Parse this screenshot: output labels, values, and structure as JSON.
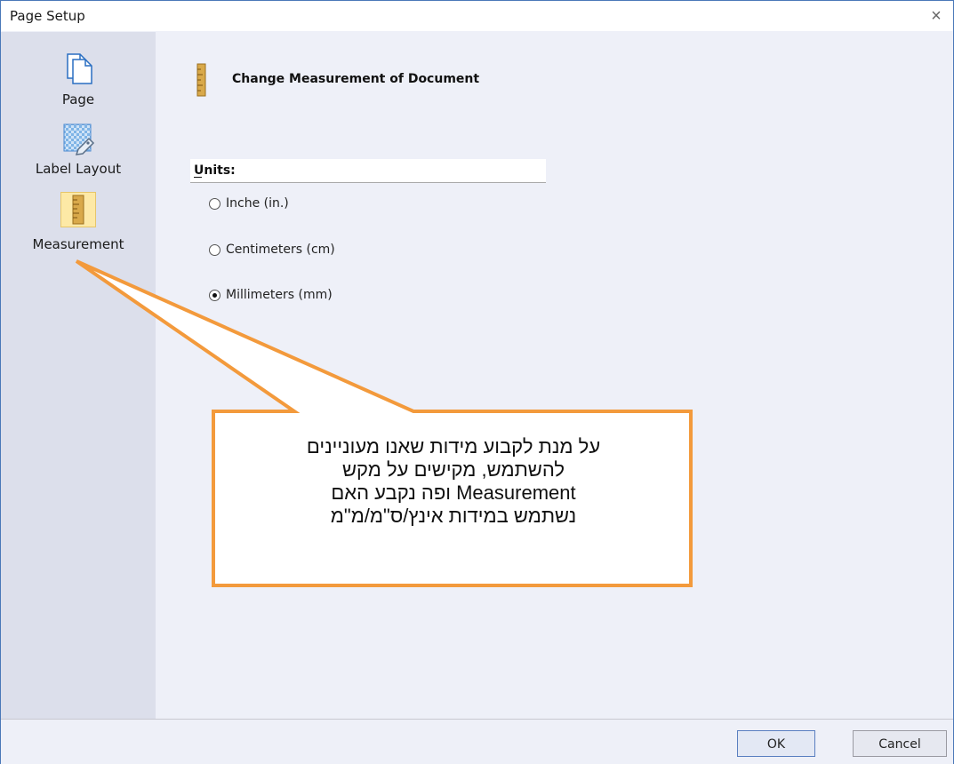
{
  "window": {
    "title": "Page Setup",
    "close_glyph": "×"
  },
  "nav": {
    "items": [
      {
        "label": "Page",
        "icon": "page-icon"
      },
      {
        "label": "Label Layout",
        "icon": "label-layout-icon"
      },
      {
        "label": "Measurement",
        "icon": "ruler-icon",
        "selected": true
      }
    ]
  },
  "content": {
    "heading": "Change Measurement of Document",
    "units_label": "Units:",
    "options": [
      {
        "label": "Inche (in.)",
        "checked": false
      },
      {
        "label": "Centimeters (cm)",
        "checked": false
      },
      {
        "label": "Millimeters (mm)",
        "checked": true
      }
    ]
  },
  "callout": {
    "lines": [
      "על מנת לקבוע מידות שאנו מעוניינים",
      "להשתמש, מקישים על מקש",
      "Measurement ופה נקבע האם",
      "נשתמש במידות אינץ/ס\"מ/מ\"מ"
    ],
    "border_color": "#f39a3c"
  },
  "footer": {
    "ok_label": "OK",
    "cancel_label": "Cancel"
  }
}
